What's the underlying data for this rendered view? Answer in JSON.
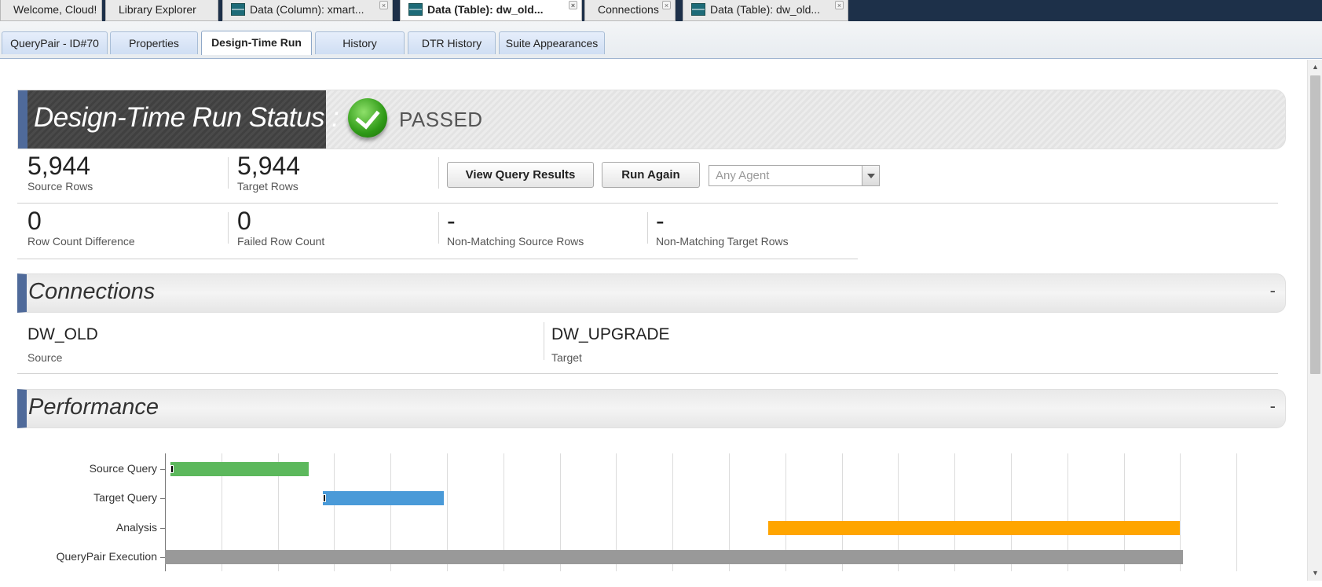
{
  "top_tabs": [
    {
      "label": "Welcome, Cloud!"
    },
    {
      "label": "Library Explorer"
    },
    {
      "label": "Data (Column): xmart..."
    },
    {
      "label": "Data (Table): dw_old..."
    },
    {
      "label": "Connections"
    },
    {
      "label": "Data (Table): dw_old..."
    }
  ],
  "sub_tabs": [
    {
      "label": "QueryPair - ID#70"
    },
    {
      "label": "Properties"
    },
    {
      "label": "Design-Time Run"
    },
    {
      "label": "History"
    },
    {
      "label": "DTR History"
    },
    {
      "label": "Suite Appearances"
    }
  ],
  "status": {
    "title": "Design-Time Run Status :",
    "value": "PASSED",
    "icon": "check-icon"
  },
  "stats": {
    "source_rows": {
      "value": "5,944",
      "label": "Source Rows"
    },
    "target_rows": {
      "value": "5,944",
      "label": "Target Rows"
    },
    "row_count_difference": {
      "value": "0",
      "label": "Row Count Difference"
    },
    "failed_row_count": {
      "value": "0",
      "label": "Failed Row Count"
    },
    "non_matching_source": {
      "value": "-",
      "label": "Non-Matching Source Rows"
    },
    "non_matching_target": {
      "value": "-",
      "label": "Non-Matching Target Rows"
    }
  },
  "actions": {
    "view_results": "View Query Results",
    "run_again": "Run Again",
    "agent_select": "Any Agent"
  },
  "connections": {
    "title": "Connections",
    "collapse": "-",
    "source": {
      "name": "DW_OLD",
      "role": "Source"
    },
    "target": {
      "name": "DW_UPGRADE",
      "role": "Target"
    }
  },
  "performance": {
    "title": "Performance",
    "collapse": "-"
  },
  "chart_data": {
    "type": "bar",
    "orientation": "horizontal-timeline",
    "categories": [
      "Source Query",
      "Target Query",
      "Analysis",
      "QueryPair Execution"
    ],
    "series": [
      {
        "start": 0.1,
        "end": 2.55,
        "color": "#5cb85c"
      },
      {
        "start": 2.8,
        "end": 4.95,
        "color": "#4a9ad8"
      },
      {
        "start": 10.7,
        "end": 18.0,
        "color": "#ffa500"
      },
      {
        "start": 0.0,
        "end": 18.05,
        "color": "#999999"
      }
    ],
    "xlim": [
      0,
      19
    ],
    "grid": true
  }
}
